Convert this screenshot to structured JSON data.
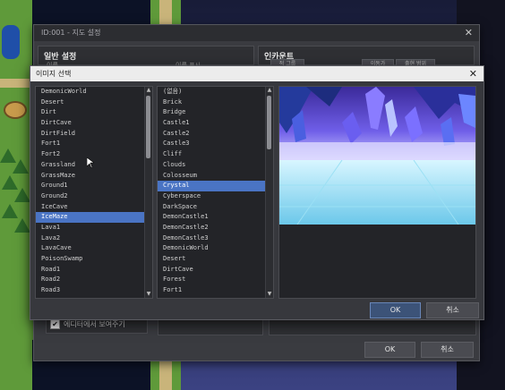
{
  "map_settings_window": {
    "title": "ID:001 - 지도 설정",
    "general_section_title": "일반 설정",
    "general_sub_labels": [
      "이름",
      "이름 표시"
    ],
    "encounter_section_title": "인카운트",
    "encounter_sub_labels": [
      "적 그룹",
      "이동가",
      "출현 범위"
    ],
    "show_in_editor_label": "에디터에서 보여주기",
    "show_in_editor_checked": "✔",
    "ok_label": "OK",
    "cancel_label": "취소"
  },
  "image_dialog": {
    "title": "이미지 선택",
    "list1": {
      "items": [
        "DemonicWorld",
        "Desert",
        "Dirt",
        "DirtCave",
        "DirtField",
        "Fort1",
        "Fort2",
        "Grassland",
        "GrassMaze",
        "Ground1",
        "Ground2",
        "IceCave",
        "IceMaze",
        "Lava1",
        "Lava2",
        "LavaCave",
        "PoisonSwamp",
        "Road1",
        "Road2",
        "Road3"
      ],
      "selected_index": 12
    },
    "list2": {
      "items": [
        "(없음)",
        "Brick",
        "Bridge",
        "Castle1",
        "Castle2",
        "Castle3",
        "Cliff",
        "Clouds",
        "Colosseum",
        "Crystal",
        "Cyberspace",
        "DarkSpace",
        "DemonCastle1",
        "DemonCastle2",
        "DemonCastle3",
        "DemonicWorld",
        "Desert",
        "DirtCave",
        "Forest",
        "Fort1"
      ],
      "selected_index": 9
    },
    "ok_label": "OK",
    "cancel_label": "취소"
  },
  "colors": {
    "selection": "#4a74c4",
    "ok_button": "#3c5378",
    "crystal_primary": "#4a5fe0",
    "crystal_highlight": "#b9c3ff",
    "ice_floor": "#7fd6ee"
  },
  "icons": {
    "close": "close-icon",
    "scroll_up": "scroll-up-arrow-icon",
    "scroll_down": "scroll-down-arrow-icon",
    "cursor": "mouse-cursor-icon",
    "check": "checkmark-icon"
  }
}
